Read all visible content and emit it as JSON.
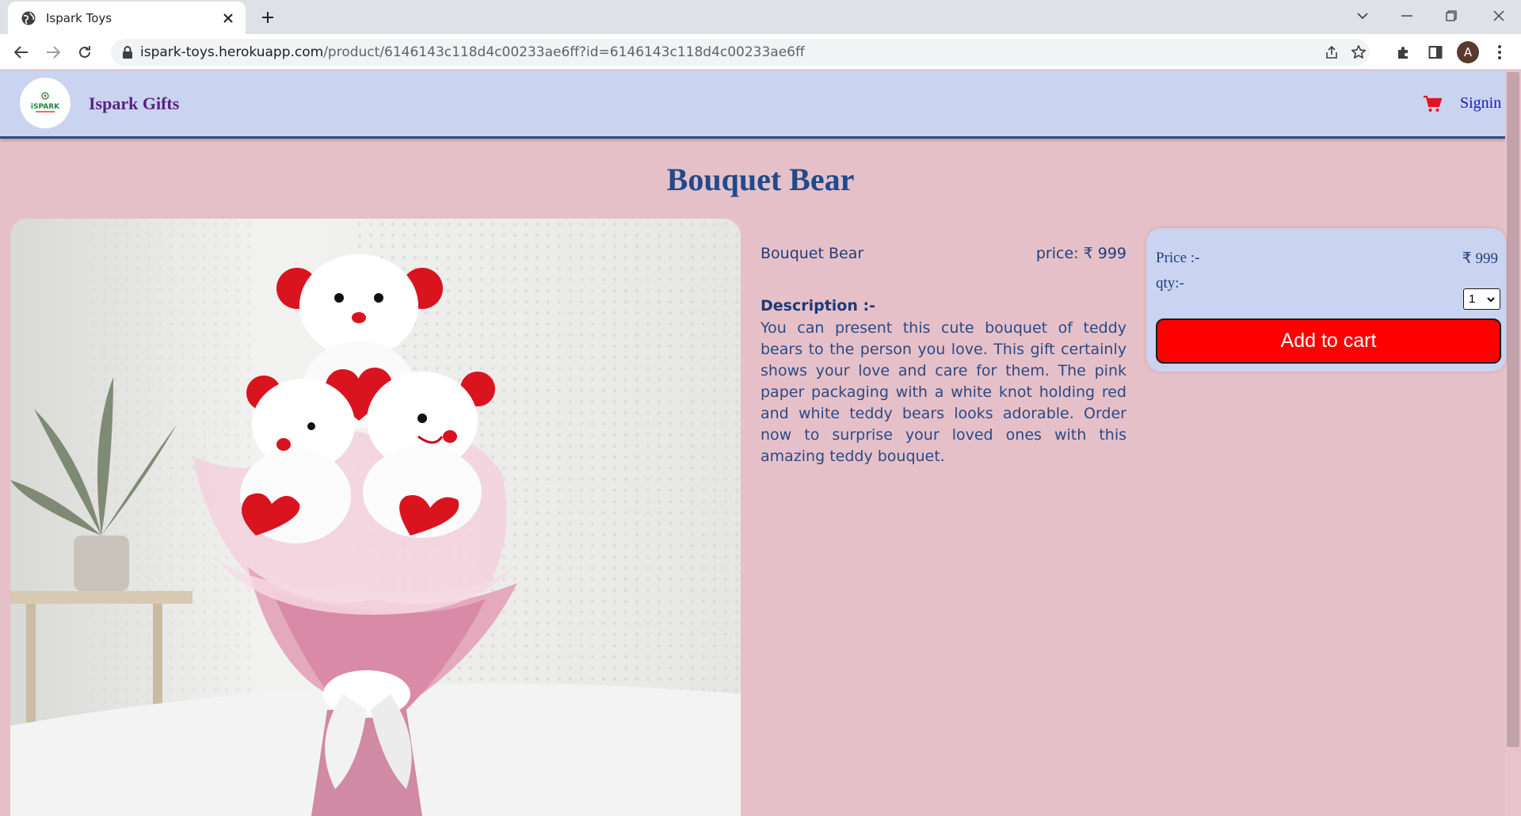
{
  "browser": {
    "tab_title": "Ispark Toys",
    "url_host": "ispark-toys.herokuapp.com",
    "url_path": "/product/6146143c118d4c00233ae6ff?id=6146143c118d4c00233ae6ff",
    "profile_initial": "A"
  },
  "navbar": {
    "brand": "Ispark Gifts",
    "logo_text": "iSPARK",
    "signin": "Signin",
    "cart_icon": "shopping-cart-icon",
    "cart_color": "#e0141e"
  },
  "product": {
    "title": "Bouquet Bear",
    "name": "Bouquet Bear",
    "price_text": "price: ₹ 999",
    "description_title": "Description :-",
    "description": "You can present this cute bouquet of teddy bears to the person you love. This gift certainly shows your love and care for them. The pink paper packaging with a white knot holding red and white teddy bears looks adorable. Order now to surprise your loved ones with this amazing teddy bouquet."
  },
  "buybox": {
    "price_label": "Price :-",
    "price_value": "₹ 999",
    "qty_label": "qty:-",
    "qty_selected": "1",
    "add_to_cart": "Add to cart",
    "button_color": "#ff0000"
  },
  "colors": {
    "page_bg": "#e6c0c8",
    "navbar_bg": "#cad3ef",
    "title_color": "#1f4b8d"
  }
}
